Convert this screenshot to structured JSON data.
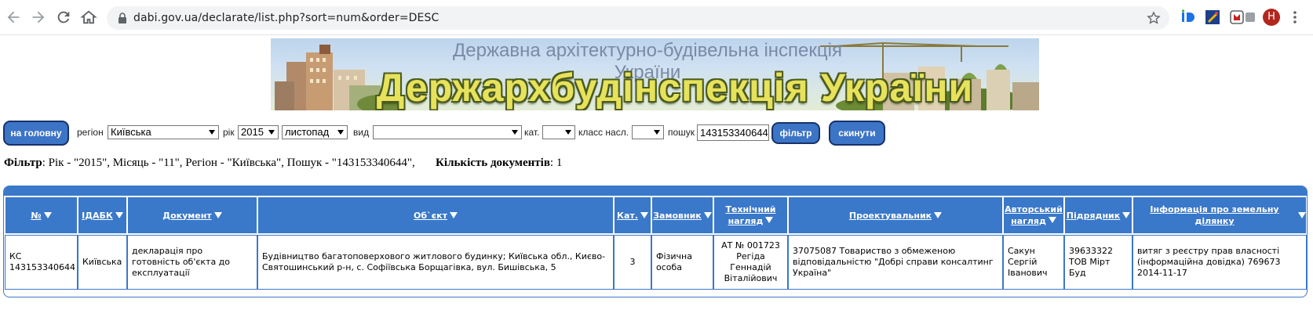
{
  "browser": {
    "url": "dabi.gov.ua/declarate/list.php?sort=num&order=DESC",
    "avatar_letter": "Н"
  },
  "banner": {
    "subtitle": "Державна архітектурно-будівельна інспекція України",
    "title": "Держархбудінспекція України"
  },
  "filters": {
    "home_button": "на головну",
    "region_label": "регіон",
    "region_value": "Київська",
    "year_label": "рік",
    "year_value": "2015",
    "month_value": "листопад",
    "type_label": "вид",
    "type_value": "",
    "cat_label": "кат.",
    "cat_value": "",
    "class_label": "класс насл.",
    "class_value": "",
    "search_label": "пошук",
    "search_value": "143153340644",
    "filter_button": "фільтр",
    "reset_button": "скинути"
  },
  "summary": {
    "filter_label": "Фільтр",
    "filter_text": ": Рік - \"2015\", Місяць - \"11\", Регіон - \"Київська\", Пошук - \"143153340644\",",
    "count_label": "Кількість документів",
    "count_value": ": 1"
  },
  "table": {
    "headers": [
      {
        "line1": "№",
        "line2": ""
      },
      {
        "line1": "ІДАБК",
        "line2": ""
      },
      {
        "line1": "Документ",
        "line2": ""
      },
      {
        "line1": "Об`єкт",
        "line2": ""
      },
      {
        "line1": "Кат.",
        "line2": ""
      },
      {
        "line1": "Замовник",
        "line2": ""
      },
      {
        "line1": "Технічний",
        "line2": "нагляд"
      },
      {
        "line1": "Проектувальник",
        "line2": ""
      },
      {
        "line1": "Авторський",
        "line2": "нагляд"
      },
      {
        "line1": "Підрядник",
        "line2": ""
      },
      {
        "line1": "Інформація про земельну ділянку",
        "line2": ""
      }
    ],
    "rows": [
      [
        "КС 143153340644",
        "Київська",
        "декларація про готовність об'єкта до експлуатації",
        "Будівництво багатоповерхового житлового будинку; Київська обл., Києво-Святошинський р-н, с. Софіївська Борщагівка, вул. Бишівська, 5",
        "3",
        "Фізична особа",
        "АТ № 001723 Регіда Геннадій Віталійович",
        "37075087 Товариство з обмеженою відповідальністю \"Добрі справи консалтинг Україна\"",
        "Сакун Сергій Іванович",
        "39633322 ТОВ Мірт Буд",
        "витяг з реєстру прав власності (інформаційна довідка) 769673 2014-11-17"
      ]
    ]
  },
  "colors": {
    "accent": "#3a78c9",
    "button": "#3c74c6",
    "button_border": "#17326a"
  }
}
